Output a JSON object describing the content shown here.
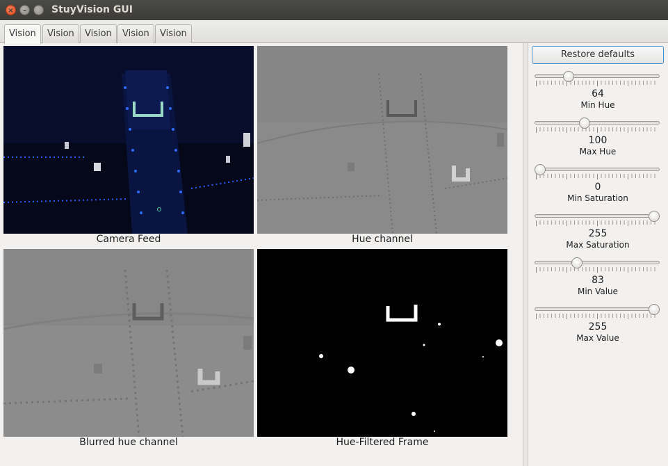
{
  "window": {
    "title": "StuyVision GUI"
  },
  "tabs": [
    {
      "label": "Vision"
    },
    {
      "label": "Vision"
    },
    {
      "label": "Vision"
    },
    {
      "label": "Vision"
    },
    {
      "label": "Vision"
    }
  ],
  "panels": {
    "camera": {
      "caption": "Camera Feed"
    },
    "hue": {
      "caption": "Hue channel"
    },
    "blurred": {
      "caption": "Blurred hue channel"
    },
    "filtered": {
      "caption": "Hue-Filtered Frame"
    }
  },
  "controls": {
    "restore_label": "Restore defaults",
    "sliders": [
      {
        "label": "Min Hue",
        "value": "64",
        "fraction": 0.251
      },
      {
        "label": "Max Hue",
        "value": "100",
        "fraction": 0.392
      },
      {
        "label": "Min Saturation",
        "value": "0",
        "fraction": 0.0
      },
      {
        "label": "Max Saturation",
        "value": "255",
        "fraction": 1.0
      },
      {
        "label": "Min Value",
        "value": "83",
        "fraction": 0.325
      },
      {
        "label": "Max Value",
        "value": "255",
        "fraction": 1.0
      }
    ]
  },
  "colors": {
    "accent": "#4a90c8",
    "close_button": "#e14d1f"
  }
}
